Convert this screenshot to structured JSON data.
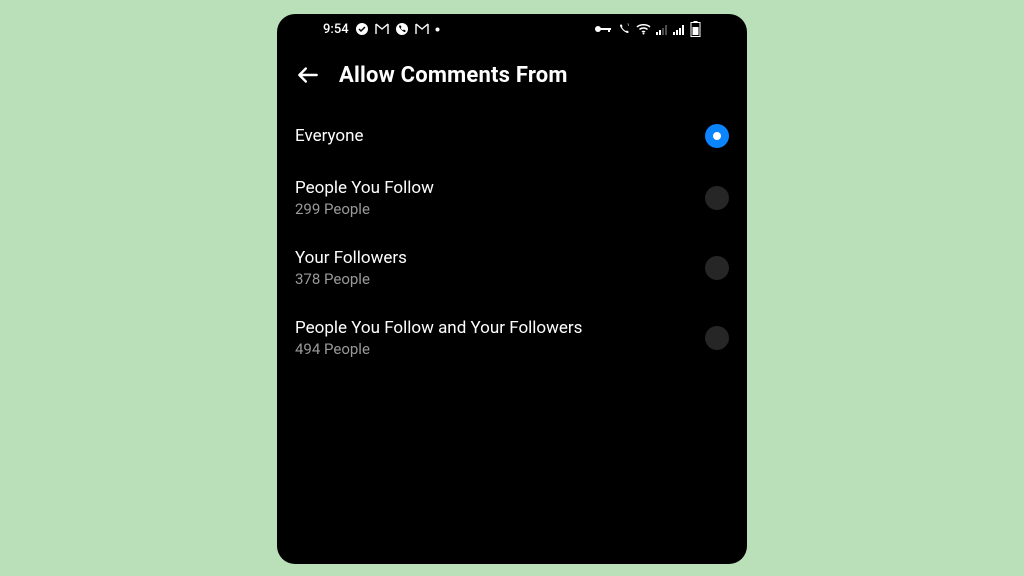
{
  "status_bar": {
    "time": "9:54",
    "left_icons": [
      "circle-icon",
      "gmail-icon",
      "phone-circle-icon",
      "gmail-icon",
      "dot-icon"
    ],
    "right_icons": [
      "key-icon",
      "volte-icon",
      "wifi-icon",
      "signal-small-icon",
      "signal-icon",
      "battery-icon"
    ]
  },
  "header": {
    "title": "Allow Comments From"
  },
  "options": [
    {
      "title": "Everyone",
      "subtitle": "",
      "selected": true
    },
    {
      "title": "People You Follow",
      "subtitle": "299 People",
      "selected": false
    },
    {
      "title": "Your Followers",
      "subtitle": "378 People",
      "selected": false
    },
    {
      "title": "People You Follow and Your Followers",
      "subtitle": "494 People",
      "selected": false
    }
  ]
}
